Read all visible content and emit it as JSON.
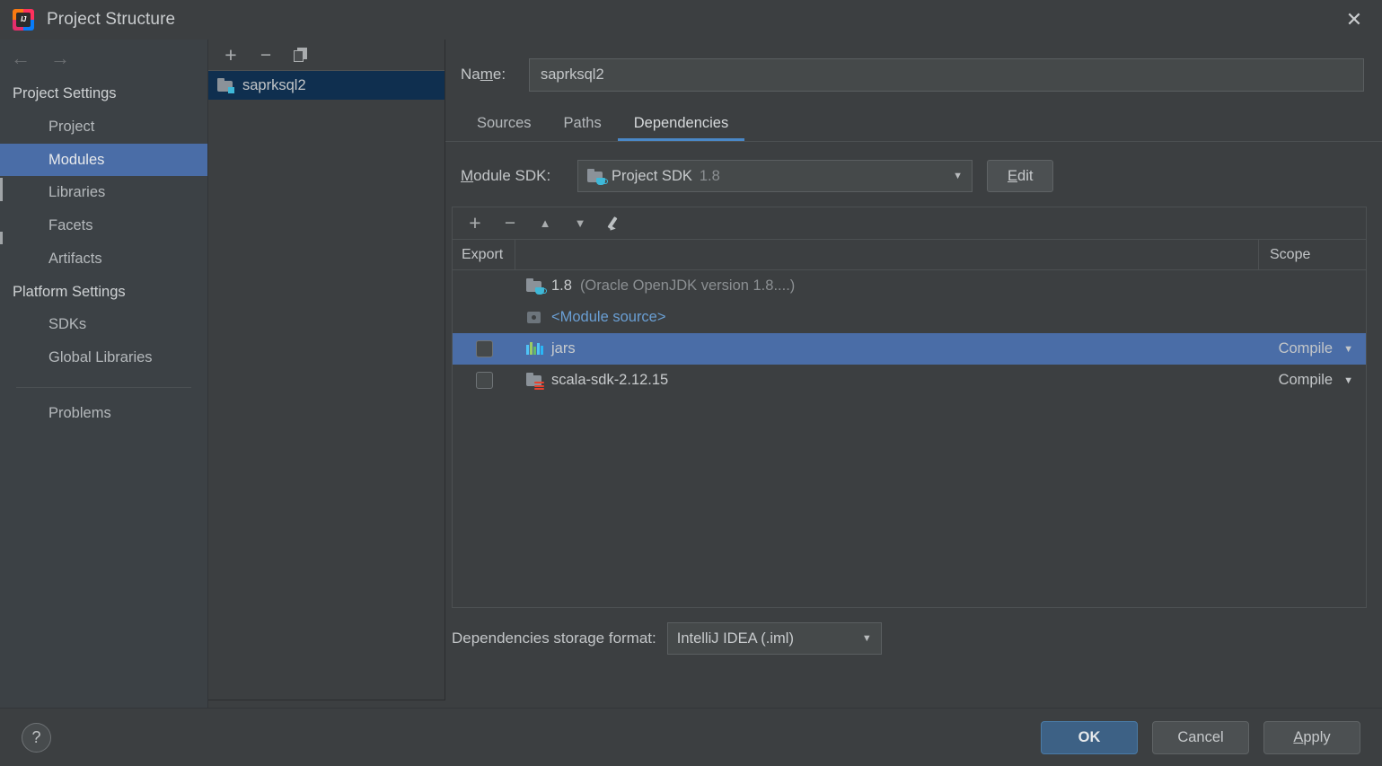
{
  "window": {
    "title": "Project Structure",
    "logo_icon": "intellij-idea-logo",
    "close_icon": "close-icon"
  },
  "nav": {
    "back_icon": "arrow-left-icon",
    "forward_icon": "arrow-right-icon"
  },
  "sidebar": {
    "groups": [
      {
        "label": "Project Settings",
        "kind": "group"
      },
      {
        "label": "Project",
        "kind": "item",
        "selected": false
      },
      {
        "label": "Modules",
        "kind": "item",
        "selected": true
      },
      {
        "label": "Libraries",
        "kind": "item",
        "selected": false
      },
      {
        "label": "Facets",
        "kind": "item",
        "selected": false
      },
      {
        "label": "Artifacts",
        "kind": "item",
        "selected": false
      },
      {
        "label": "Platform Settings",
        "kind": "group"
      },
      {
        "label": "SDKs",
        "kind": "item",
        "selected": false
      },
      {
        "label": "Global Libraries",
        "kind": "item",
        "selected": false
      },
      {
        "label": "Problems",
        "kind": "item",
        "selected": false
      }
    ]
  },
  "modules_panel": {
    "toolbar": [
      {
        "icon": "plus-icon",
        "label": "+"
      },
      {
        "icon": "minus-icon",
        "label": "−"
      },
      {
        "icon": "copy-icon",
        "label": "Copy"
      }
    ],
    "items": [
      {
        "name": "saprksql2",
        "icon": "module-folder-icon",
        "selected": true
      }
    ]
  },
  "detail": {
    "name_label": "Name:",
    "name_mnemonic": "m",
    "name_value": "saprksql2",
    "name_placeholder": "",
    "tabs": [
      {
        "label": "Sources",
        "active": false
      },
      {
        "label": "Paths",
        "active": false
      },
      {
        "label": "Dependencies",
        "active": true
      }
    ],
    "module_sdk_label": "Module SDK:",
    "module_sdk_mnemonic": "M",
    "module_sdk_value": "Project SDK",
    "module_sdk_version": "1.8",
    "module_sdk_icon": "jdk-folder-icon",
    "edit_button": "Edit",
    "edit_mnemonic": "E",
    "dep_toolbar": [
      {
        "icon": "plus-icon",
        "label": "+"
      },
      {
        "icon": "minus-icon",
        "label": "−"
      },
      {
        "icon": "arrow-up-icon",
        "label": "▲"
      },
      {
        "icon": "arrow-down-icon",
        "label": "▼"
      },
      {
        "icon": "pencil-edit-icon",
        "label": "Edit"
      }
    ],
    "table": {
      "columns": [
        {
          "key": "export",
          "label": "Export"
        },
        {
          "key": "name",
          "label": ""
        },
        {
          "key": "scope",
          "label": "Scope"
        }
      ],
      "rows": [
        {
          "export_visible": false,
          "export_checked": false,
          "icon": "jdk-folder-icon",
          "name": "1.8",
          "name_detail": "(Oracle OpenJDK version 1.8....)",
          "name_style": "main",
          "scope": "",
          "selected": false
        },
        {
          "export_visible": false,
          "export_checked": false,
          "icon": "module-source-icon",
          "name": "<Module source>",
          "name_detail": "",
          "name_style": "link",
          "scope": "",
          "selected": false
        },
        {
          "export_visible": true,
          "export_checked": false,
          "icon": "library-bars-icon",
          "name": "jars",
          "name_detail": "",
          "name_style": "main",
          "scope": "Compile",
          "selected": true
        },
        {
          "export_visible": true,
          "export_checked": false,
          "icon": "scala-sdk-folder-icon",
          "name": "scala-sdk-2.12.15",
          "name_detail": "",
          "name_style": "main",
          "scope": "Compile",
          "selected": false
        }
      ]
    },
    "storage_label": "Dependencies storage format:",
    "storage_value": "IntelliJ IDEA (.iml)"
  },
  "footer": {
    "help_icon": "help-question-icon",
    "help_label": "?",
    "buttons": [
      {
        "label": "OK",
        "primary": true,
        "mnemonic": ""
      },
      {
        "label": "Cancel",
        "primary": false,
        "mnemonic": ""
      },
      {
        "label": "Apply",
        "primary": false,
        "mnemonic": "A"
      }
    ]
  },
  "colors": {
    "window_bg": "#3c3f41",
    "sidebar_bg": "#3c4145",
    "selection_blue": "#4a6da7",
    "inactive_selection": "#0f2f4f",
    "tab_accent": "#4a88c7",
    "primary_button": "#3d6185",
    "link": "#6a9fd4",
    "text": "#c3c6c8",
    "text_dim": "#8b8f92"
  }
}
